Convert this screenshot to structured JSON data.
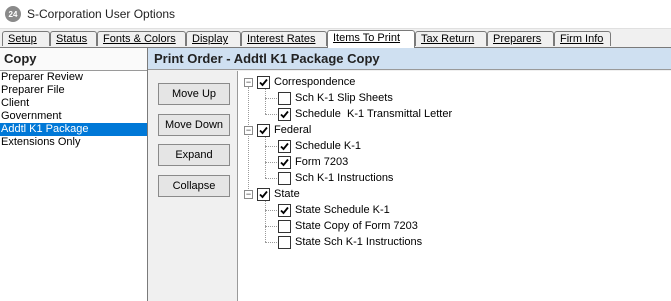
{
  "window": {
    "icon_text": "24",
    "title": "S-Corporation User Options"
  },
  "tabs": [
    {
      "label": "Setup"
    },
    {
      "label": "Status"
    },
    {
      "label": "Fonts & Colors"
    },
    {
      "label": "Display"
    },
    {
      "label": "Interest Rates"
    },
    {
      "label": "Items To Print",
      "active": true
    },
    {
      "label": "Tax Return"
    },
    {
      "label": "Preparers"
    },
    {
      "label": "Firm Info"
    }
  ],
  "left_panel": {
    "header": "Copy",
    "items": [
      {
        "label": "Preparer Review"
      },
      {
        "label": "Preparer File"
      },
      {
        "label": "Client"
      },
      {
        "label": "Government"
      },
      {
        "label": "Addtl K1 Package",
        "selected": true
      },
      {
        "label": "Extensions Only"
      }
    ]
  },
  "right_panel": {
    "header": "Print Order - Addtl K1 Package Copy",
    "buttons": {
      "move_up": "Move Up",
      "move_down": "Move Down",
      "expand": "Expand",
      "collapse": "Collapse"
    },
    "tree": [
      {
        "label": "Correspondence",
        "checked": true,
        "expanded": true,
        "children": [
          {
            "label": "Sch K-1 Slip Sheets",
            "checked": false
          },
          {
            "label": "Schedule  K-1 Transmittal Letter",
            "checked": true
          }
        ]
      },
      {
        "label": "Federal",
        "checked": true,
        "expanded": true,
        "children": [
          {
            "label": "Schedule K-1",
            "checked": true
          },
          {
            "label": "Form 7203",
            "checked": true
          },
          {
            "label": "Sch K-1 Instructions",
            "checked": false
          }
        ]
      },
      {
        "label": "State",
        "checked": true,
        "expanded": true,
        "children": [
          {
            "label": "State Schedule K-1",
            "checked": true
          },
          {
            "label": "State Copy of Form 7203",
            "checked": false
          },
          {
            "label": "State Sch K-1 Instructions",
            "checked": false
          }
        ]
      }
    ]
  }
}
